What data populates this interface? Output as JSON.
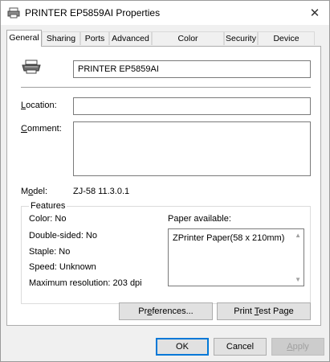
{
  "window": {
    "title": "PRINTER EP5859AI Properties",
    "close_glyph": "✕"
  },
  "tabs": [
    {
      "label": "General",
      "active": true
    },
    {
      "label": "Sharing"
    },
    {
      "label": "Ports"
    },
    {
      "label": "Advanced"
    },
    {
      "label": "Color Management"
    },
    {
      "label": "Security"
    },
    {
      "label": "Device Settings"
    }
  ],
  "general": {
    "printer_name": "PRINTER EP5859AI",
    "location_label_pre": "",
    "location_label_key": "L",
    "location_label_post": "ocation:",
    "location_value": "",
    "comment_label_key": "C",
    "comment_label_post": "omment:",
    "comment_value": "",
    "model_label_pre": "M",
    "model_label_key": "o",
    "model_label_post": "del:",
    "model_value": "ZJ-58 11.3.0.1"
  },
  "features": {
    "title": "Features",
    "color": "Color: No",
    "double_sided": "Double-sided: No",
    "staple": "Staple: No",
    "speed": "Speed: Unknown",
    "max_resolution": "Maximum resolution: 203 dpi",
    "paper_label": "Paper available:",
    "paper_items": [
      "ZPrinter Paper(58 x 210mm)"
    ]
  },
  "buttons": {
    "preferences_pre": "Pr",
    "preferences_key": "e",
    "preferences_post": "ferences...",
    "print_test_pre": "Print ",
    "print_test_key": "T",
    "print_test_post": "est Page",
    "ok": "OK",
    "cancel": "Cancel",
    "apply_key": "A",
    "apply_post": "pply"
  },
  "colors": {
    "accent": "#0078d7",
    "panel_bg": "#ffffff",
    "window_bg": "#f0f0f0"
  }
}
